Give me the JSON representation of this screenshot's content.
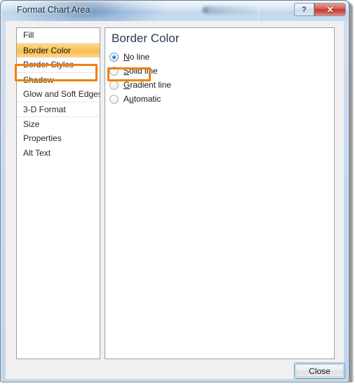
{
  "window": {
    "title": "Format Chart Area",
    "help_button_label": "?",
    "close_button_label": "✕"
  },
  "categories": {
    "items": [
      {
        "label": "Fill",
        "selected": false,
        "separator_above": false
      },
      {
        "label": "Border Color",
        "selected": true,
        "separator_above": true
      },
      {
        "label": "Border Styles",
        "selected": false,
        "separator_above": false
      },
      {
        "label": "Shadow",
        "selected": false,
        "separator_above": true
      },
      {
        "label": "Glow and Soft Edges",
        "selected": false,
        "separator_above": false
      },
      {
        "label": "3-D Format",
        "selected": false,
        "separator_above": true
      },
      {
        "label": "Size",
        "selected": false,
        "separator_above": true
      },
      {
        "label": "Properties",
        "selected": false,
        "separator_above": false
      },
      {
        "label": "Alt Text",
        "selected": false,
        "separator_above": false
      }
    ]
  },
  "content": {
    "heading": "Border Color",
    "radios": [
      {
        "label_before": "",
        "accel": "N",
        "label_after": "o line",
        "checked": true
      },
      {
        "label_before": "",
        "accel": "S",
        "label_after": "olid line",
        "checked": false
      },
      {
        "label_before": "",
        "accel": "G",
        "label_after": "radient line",
        "checked": false
      },
      {
        "label_before": "A",
        "accel": "u",
        "label_after": "tomatic",
        "checked": false
      }
    ]
  },
  "footer": {
    "close_label": "Close"
  },
  "annotations": {
    "highlight_color": "#f07f13",
    "selected_item_fill": "#fbc765"
  }
}
